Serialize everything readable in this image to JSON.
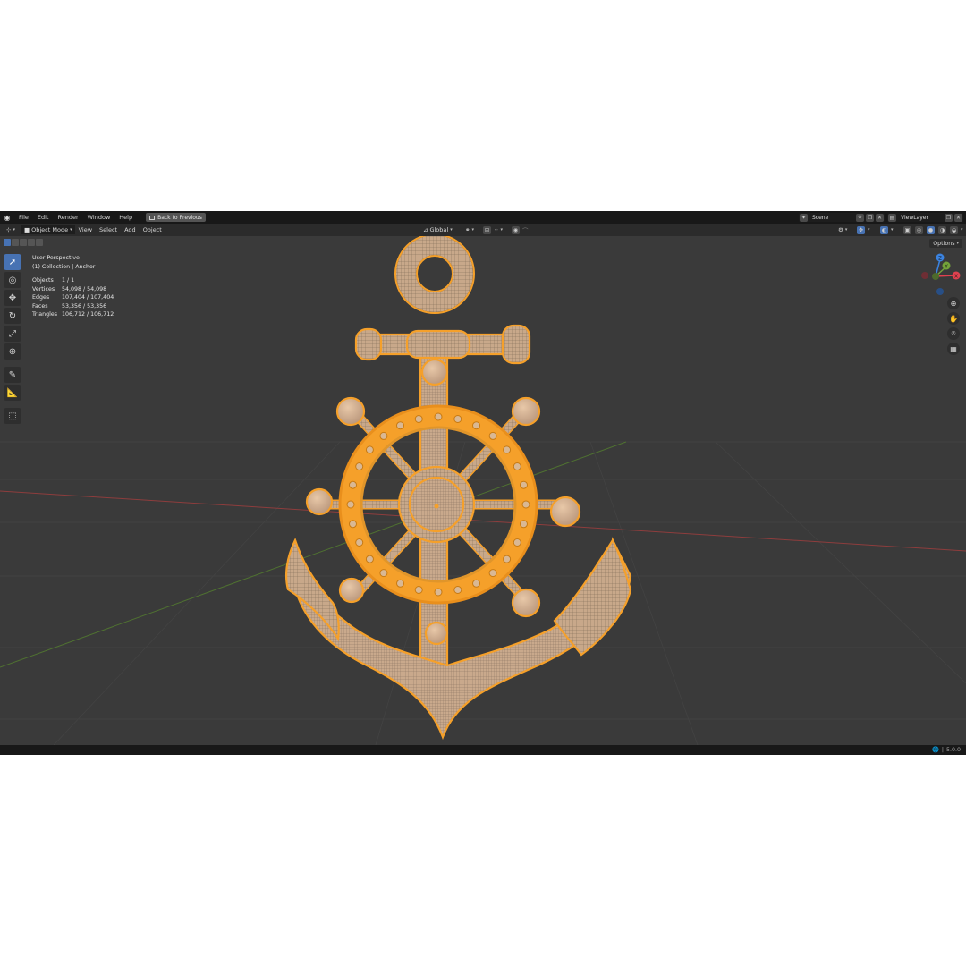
{
  "menu": {
    "items": [
      "File",
      "Edit",
      "Render",
      "Window",
      "Help"
    ],
    "back_button": "Back to Previous"
  },
  "scene": {
    "name": "Scene"
  },
  "view_layer": {
    "name": "ViewLayer"
  },
  "header": {
    "mode": "Object Mode",
    "items": [
      "View",
      "Select",
      "Add",
      "Object"
    ],
    "transform_orientation": "Global"
  },
  "overlay": {
    "perspective": "User Perspective",
    "collection": "(1) Collection | Anchor",
    "stats": [
      {
        "label": "Objects",
        "value": "1 / 1"
      },
      {
        "label": "Vertices",
        "value": "54,098 / 54,098"
      },
      {
        "label": "Edges",
        "value": "107,404 / 107,404"
      },
      {
        "label": "Faces",
        "value": "53,356 / 53,356"
      },
      {
        "label": "Triangles",
        "value": "106,712 / 106,712"
      }
    ]
  },
  "options_label": "Options",
  "gizmo": {
    "z": "Z",
    "x": "X",
    "y": "Y"
  },
  "status": {
    "version": "5.0.0"
  },
  "colors": {
    "accent": "#4772b3",
    "selection_orange": "#f5a02a",
    "viewport_bg": "#3a3a3a",
    "x_axis": "#e0414f",
    "y_axis": "#74a33a",
    "z_axis": "#3b83e0"
  },
  "icons": {
    "tools": [
      "select-box-icon",
      "cursor-icon",
      "move-icon",
      "rotate-icon",
      "scale-icon",
      "transform-icon",
      "annotate-icon",
      "measure-icon",
      "add-cube-icon"
    ],
    "nav": [
      "zoom-icon",
      "pan-hand-icon",
      "camera-icon",
      "grid-ortho-icon"
    ]
  }
}
